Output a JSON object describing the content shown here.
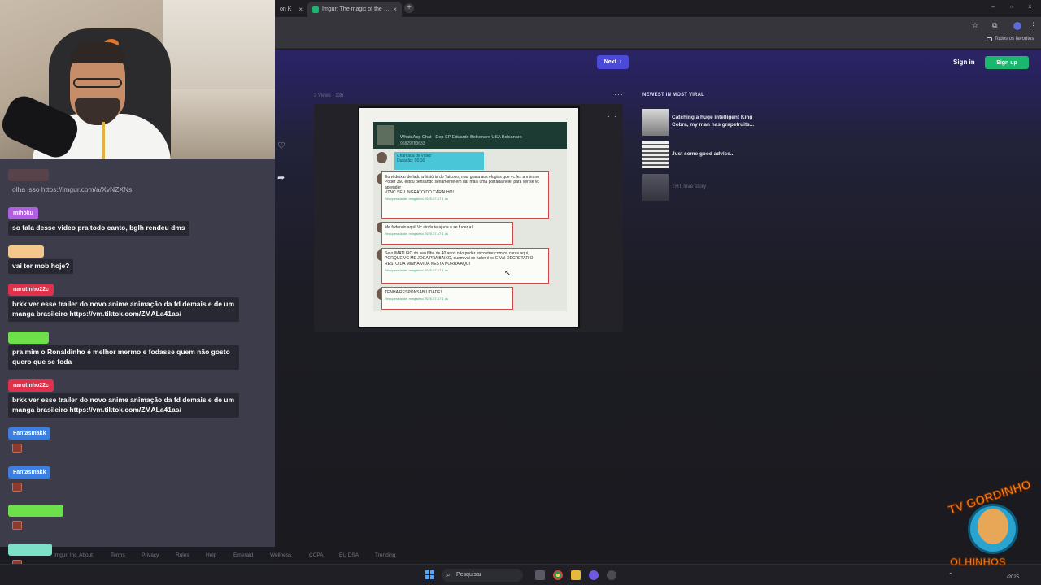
{
  "browser": {
    "tabs": [
      {
        "label": "on K"
      },
      {
        "label": "Imgur: The magic of the Internet"
      }
    ],
    "bookmarks_folder": "Todos os favoritos"
  },
  "imgur": {
    "next_label": "Next",
    "sign_in": "Sign in",
    "sign_up": "Sign up",
    "post_meta": "3 Views · 13h",
    "sidebar_title": "NEWEST IN MOST VIRAL",
    "sidebar_items": [
      {
        "title": "Catching a huge intelligent King Cobra, my man has grapefruits..."
      },
      {
        "title": "Just some good advice..."
      },
      {
        "title": "THT love story"
      }
    ],
    "image": {
      "chat_title": "WhatsApp Chat - Dep SP Eduardo Bolsonaro USA Bolsonaro",
      "chat_number": "96829783633",
      "call_text": "Chamada de vídeo",
      "call_duration": "Duração: 00:16",
      "bubbles": [
        {
          "text": "Eu vi deixar de lado a história do Tatcoso, mas graça aos elogios que vc fez a mim no Poder 360 estou pensando seriamente em dar mais uma porrada nele, para ver se vc aprender",
          "text2": "VTNC SEU INGRATO DO CARALHO!"
        },
        {
          "text": "Me fudendo aqui! Vc ainda te ajuda a se fuder aí!"
        },
        {
          "text": "Se o IMATURO do seu filho de 40 anos não puder encontrar com os caras aqui, PORQUE VC ME JOGA PRA BAIXO, quem vai se fuder é vc E VAI DECRETAR O RESTO DA MINHA VIDA NESTA PORRA AQUI"
        },
        {
          "text": "TENHA RESPONSABILIDADE!"
        }
      ],
      "recovered_label": "Recuperada de: mingalexo 2025-07-17 1 ds"
    },
    "footer": [
      "Imgur, Inc",
      "About",
      "Terms",
      "Privacy",
      "Rules",
      "Help",
      "Emerald",
      "Wellness",
      "CCPA",
      "EU DSA",
      "Trending"
    ]
  },
  "chat": {
    "messages": [
      {
        "user": "",
        "user_color": "#7b4b4b",
        "text": "olha isso https://imgur.com/a/XvNZXNs"
      },
      {
        "user": "mihoku",
        "user_color": "#b05fe0",
        "text": "so fala desse video pra todo canto, bglh rendeu dms"
      },
      {
        "user": "",
        "user_color": "#f4c78a",
        "text": "vai ter mob hoje?"
      },
      {
        "user": "narutinho22c",
        "user_color": "#e0304a",
        "text": "brkk ver esse trailer do novo anime animação da fd demais e de um manga brasileiro https://vm.tiktok.com/ZMALa41as/"
      },
      {
        "user": "",
        "user_color": "#6ee04a",
        "text": "pra mim o Ronaldinho é melhor mermo e fodasse quem não gosto quero que se foda"
      },
      {
        "user": "narutinho22c",
        "user_color": "#e0304a",
        "text": "brkk ver esse trailer do novo anime animação da fd demais e de um manga brasileiro https://vm.tiktok.com/ZMALa41as/"
      },
      {
        "user": "Fantasmakk",
        "user_color": "#3d7fe0",
        "text": ""
      },
      {
        "user": "Fantasmakk",
        "user_color": "#3d7fe0",
        "text": ""
      },
      {
        "user": "",
        "user_color": "#6ee04a",
        "text": ""
      },
      {
        "user": "",
        "user_color": "#7fe0c8",
        "text": ""
      }
    ]
  },
  "taskbar": {
    "search_label": "Pesquisar",
    "date": "/2025"
  },
  "logo": {
    "top": "TV GORDINHO",
    "bottom": "OLHINHOS"
  }
}
